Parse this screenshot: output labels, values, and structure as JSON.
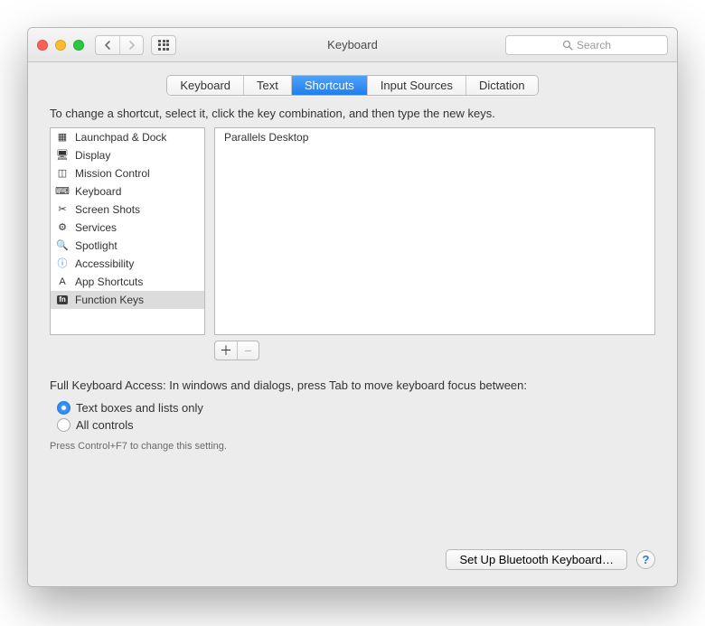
{
  "window": {
    "title": "Keyboard",
    "search_placeholder": "Search"
  },
  "tabs": [
    {
      "label": "Keyboard",
      "active": false
    },
    {
      "label": "Text",
      "active": false
    },
    {
      "label": "Shortcuts",
      "active": true
    },
    {
      "label": "Input Sources",
      "active": false
    },
    {
      "label": "Dictation",
      "active": false
    }
  ],
  "instruction": "To change a shortcut, select it, click the key combination, and then type the new keys.",
  "categories": [
    {
      "label": "Launchpad & Dock",
      "icon": "launchpad",
      "selected": false
    },
    {
      "label": "Display",
      "icon": "display",
      "selected": false
    },
    {
      "label": "Mission Control",
      "icon": "mission",
      "selected": false
    },
    {
      "label": "Keyboard",
      "icon": "keyboard",
      "selected": false
    },
    {
      "label": "Screen Shots",
      "icon": "screenshots",
      "selected": false
    },
    {
      "label": "Services",
      "icon": "services",
      "selected": false
    },
    {
      "label": "Spotlight",
      "icon": "spotlight",
      "selected": false
    },
    {
      "label": "Accessibility",
      "icon": "accessibility",
      "selected": false
    },
    {
      "label": "App Shortcuts",
      "icon": "appshortcuts",
      "selected": false
    },
    {
      "label": "Function Keys",
      "icon": "fn",
      "selected": true
    }
  ],
  "apps": [
    {
      "label": "Parallels Desktop"
    }
  ],
  "full_access": {
    "text": "Full Keyboard Access: In windows and dialogs, press Tab to move keyboard focus between:",
    "options": [
      {
        "label": "Text boxes and lists only",
        "checked": true
      },
      {
        "label": "All controls",
        "checked": false
      }
    ],
    "hint": "Press Control+F7 to change this setting."
  },
  "footer": {
    "bluetooth_button": "Set Up Bluetooth Keyboard…"
  },
  "icons": {
    "launchpad": "▦",
    "display": "🖥",
    "mission": "◫",
    "keyboard": "⌨",
    "screenshots": "✂",
    "services": "⚙",
    "spotlight": "🔍",
    "accessibility": "ⓘ",
    "appshortcuts": "A",
    "fn": "fn"
  }
}
